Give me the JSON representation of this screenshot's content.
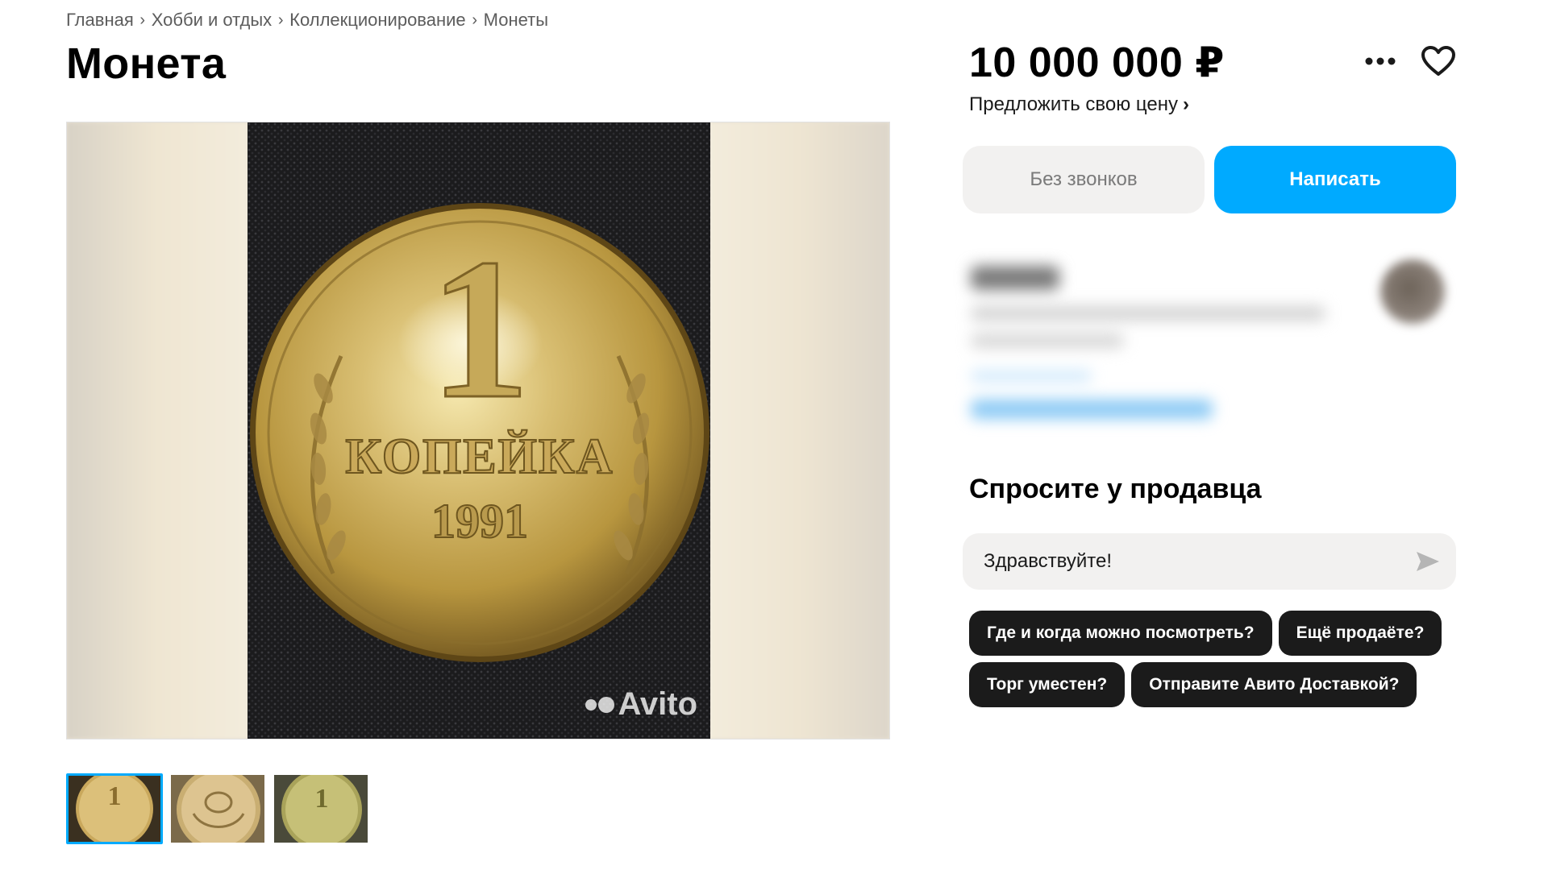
{
  "breadcrumb": {
    "items": [
      "Главная",
      "Хобби и отдых",
      "Коллекционирование",
      "Монеты"
    ],
    "separator": "›"
  },
  "listing": {
    "title": "Монета",
    "price": "10 000 000 ₽",
    "offer_price_label": "Предложить свою цену",
    "offer_price_chevron": "›"
  },
  "actions": {
    "more_icon": "more-dots-icon",
    "favorite_icon": "heart-icon",
    "no_calls_label": "Без звонков",
    "write_label": "Написать"
  },
  "gallery": {
    "watermark": "Avito",
    "coin_text": {
      "denomination": "1",
      "word": "КОПЕЙКА",
      "year": "1991"
    },
    "thumbnails": [
      {
        "label": "coin-reverse",
        "active": true
      },
      {
        "label": "coin-obverse",
        "active": false
      },
      {
        "label": "coin-reverse-alt",
        "active": false
      }
    ]
  },
  "ask_seller": {
    "title": "Спросите у продавца",
    "input_value": "Здравствуйте!",
    "send_icon": "send-icon",
    "chips": [
      "Где и когда можно посмотреть?",
      "Ещё продаёте?",
      "Торг уместен?",
      "Отправите Авито Доставкой?"
    ]
  },
  "colors": {
    "accent": "#00aaff",
    "chip_bg": "#1b1b1b",
    "muted_button_bg": "#f2f1f0"
  }
}
